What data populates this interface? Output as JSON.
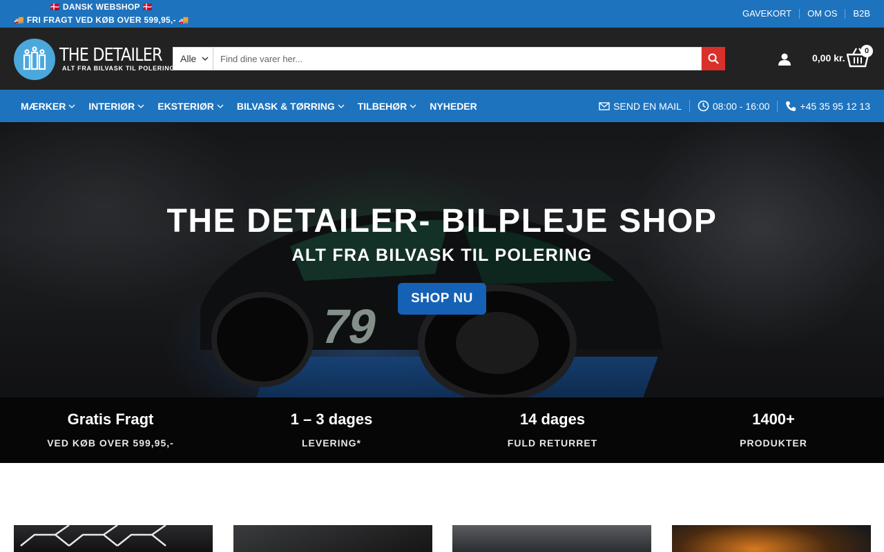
{
  "topbar": {
    "promo_line1": "🇩🇰 DANSK WEBSHOP 🇩🇰",
    "promo_line2": "🚚 FRI FRAGT VED KØB OVER 599,95,- 🚚",
    "links": [
      "GAVEKORT",
      "OM OS",
      "B2B"
    ]
  },
  "header": {
    "logo_title": "THE DETAILER",
    "logo_tagline": "ALT FRA BILVASK TIL POLERING",
    "search": {
      "category_value": "Alle",
      "placeholder": "Find dine varer her..."
    },
    "cart": {
      "amount": "0,00 kr.",
      "count": "0"
    }
  },
  "nav": {
    "items": [
      "MÆRKER",
      "INTERIØR",
      "EKSTERIØR",
      "BILVASK & TØRRING",
      "TILBEHØR",
      "NYHEDER"
    ],
    "contact": {
      "mail": "SEND EN MAIL",
      "hours": "08:00 - 16:00",
      "phone": "+45 35 95 12 13"
    }
  },
  "hero": {
    "title": "THE DETAILER- BILPLEJE SHOP",
    "subtitle": "ALT FRA BILVASK TIL POLERING",
    "button": "SHOP NU",
    "car_number": "79"
  },
  "stats": [
    {
      "value": "Gratis Fragt",
      "label": "VED KØB OVER 599,95,-"
    },
    {
      "value": "1 – 3 dages",
      "label": "LEVERING*"
    },
    {
      "value": "14 dages",
      "label": "FULD RETURRET"
    },
    {
      "value": "1400+",
      "label": "PRODUKTER"
    }
  ],
  "colors": {
    "brand_blue": "#1e73be",
    "header_dark": "#222222",
    "search_button_red": "#d9302c",
    "hero_button": "#1561b5",
    "logo_blue": "#4ba8dc"
  }
}
